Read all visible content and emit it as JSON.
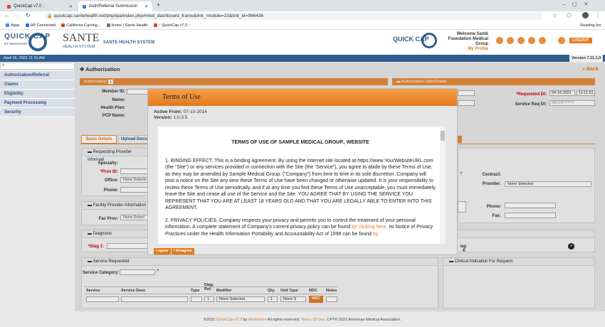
{
  "browser": {
    "tabs": [
      {
        "label": "QuickCap v7.0 :: ",
        "favicon_color": "#d44638"
      },
      {
        "label": "Auth/Referral Submission",
        "favicon_color": "#3a7bd5"
      }
    ],
    "url": "quickcap.santehealth.net/php/ipa/index.php#med_dashboard_frame&link_module=23&link_id=966436",
    "reading_list": "Reading list",
    "bookmarks": [
      {
        "label": "Apps",
        "color": "#4285f4"
      },
      {
        "label": "HP Connected",
        "color": "#1a73e8"
      },
      {
        "label": "California Carving...",
        "color": "#d44638"
      },
      {
        "label": "Home | Sante Health",
        "color": "#777"
      },
      {
        "label": ":: QuickCap v7.0 ::",
        "color": "#d44638"
      }
    ]
  },
  "header": {
    "quickcap_logo": "QUICK CAP",
    "medvision": "BY MEDVISION",
    "sante_logo": "SANTE",
    "sante_sub": "HEALTH SYSTEM",
    "system_name": "SANTE HEALTH SYSTEM",
    "welcome_line1": "Welcome Santé",
    "welcome_line2": "Foundation Medical",
    "welcome_line3": "Group",
    "my_profile": "My Profile",
    "logout": "LOGOUT",
    "date_time": "April 16, 2021 11:11 AM",
    "version": "Version 7.21.1.0"
  },
  "sidebar": {
    "items": [
      "Authorization/Referral",
      "Claims",
      "Eligibility",
      "Payment Processing",
      "Security"
    ]
  },
  "main": {
    "page_title": "Authorization",
    "back": "Back",
    "auth_bar": "Authorization",
    "auth_date_bar": "Authorization Date/Details",
    "member_id": "Member ID:",
    "name": "Name:",
    "health_plan": "Health Plan:",
    "pcp_name": "PCP Name:",
    "requested_dt": "*Requested Dt:",
    "requested_dt_value": "04-16-2021",
    "requested_time_value": "11:11:51",
    "service_req_dt": "Service Req Dt:",
    "service_req_placeholder": "MM-DD-YYYY",
    "tab_basic": "Basic Details",
    "tab_upload": "Upload Docu",
    "req_provider": "Requesting Provider Informati",
    "specialty": "Specialty:",
    "prov_id": "*Prov ID:",
    "office": "Office:",
    "office_value": "None Selecte",
    "phone": "Phone:",
    "contract": "Contract:",
    "provider": "Provider:",
    "provider_value": "None Selected",
    "phone2": "Phone:",
    "fax": "Fax:",
    "facility_provider": "Facility Provider Information",
    "fac_prov": "Fac Prov:",
    "fac_prov_value": "None Select",
    "diagnosis": "Diagnosis",
    "diag1": "*Diag 1:",
    "diag4": "iag 4:",
    "service_requested": "Service Requested",
    "service_category": "Service Category:",
    "clinical": "Clinical Indication For Request",
    "col_service": "Service",
    "col_service_desc": "Service Desc.",
    "col_type": "Type",
    "col_diag_ref": "Diag. Ref.",
    "col_modifier": "Modifier",
    "col_qty": "Qty.",
    "col_unit_type": "Unit Type",
    "col_ndc": "NDC",
    "col_notes": "Notes",
    "row_diag_ref": "1",
    "row_modifier": "None Selected",
    "row_qty": "1",
    "row_unit": "None S",
    "row_ndc": "NDC"
  },
  "modal": {
    "title": "Terms of Use",
    "active_from_label": "Active From:",
    "active_from": "07-10-2014",
    "version_label": "Version:",
    "version": "1.0.3.5",
    "doc_title": "TERMS OF USE OF SAMPLE MEDICAL GROUP., WEBSITE",
    "para1": "1. BINDING EFFECT. This is a binding agreement. By using the Internet site located at https://www.YourWebsiteURL.com (the “Site”) or any services provided in connection with the Site (the “Service”), you agree to abide by these Terms of Use, as they may be amended by Sample Medical Group. (“Company”) from time to time in its sole discretion. Company will post a notice on the Site any time these Terms of Use have been changed or otherwise updated. It is your responsibility to review these Terms of Use periodically, and if at any time you find these Terms of Use unacceptable, you must immediately leave the Site and cease all use of the Service and the Site. YOU AGREE THAT BY USING THE SERVICE YOU REPRESENT THAT YOU ARE AT LEAST 18 YEARS OLD AND THAT YOU ARE LEGALLY ABLE TO ENTER INTO THIS AGREEMENT.",
    "para2_a": "2. PRIVACY POLICIES. Company respects your privacy and permits you to control the treatment of your personal information. A complete statement of Company’s current privacy policy can be found ",
    "para2_link": "by clicking here",
    "para2_b": ". Its Notice of Privacy Practices under the Health Information Portability and Accountability Act of 1996 can be found ",
    "para2_link2": "by",
    "agree": "I agree",
    "disagree": "I disagree"
  },
  "footer": {
    "left": "©2021 ",
    "quickcap": "QuickCap v7.0",
    "by": " by ",
    "medvision": "MedVision",
    "rights": " All rights reserved. ",
    "terms": "Terms Of Use.",
    "cpt": "  CPT® 2021 American Medical Association."
  }
}
